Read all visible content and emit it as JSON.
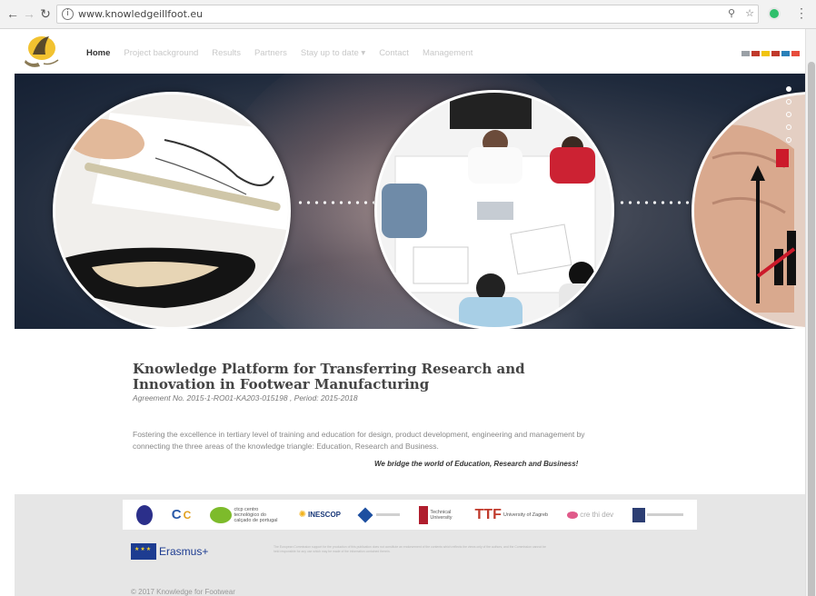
{
  "browser": {
    "url": "www.knowledgeillfoot.eu",
    "icons": [
      "back-arrow-icon",
      "forward-arrow-icon",
      "reload-icon",
      "info-icon",
      "zoom-icon",
      "star-icon",
      "extension-icon",
      "menu-icon"
    ]
  },
  "header": {
    "logo_icon": "shoe-logo-icon",
    "nav": [
      {
        "label": "Home",
        "active": true
      },
      {
        "label": "Project background"
      },
      {
        "label": "Results"
      },
      {
        "label": "Partners"
      },
      {
        "label": "Stay up to date ▾"
      },
      {
        "label": "Contact"
      },
      {
        "label": "Management"
      }
    ],
    "flags": [
      "#9aa0a6",
      "#c0392b",
      "#f1c40f",
      "#c0392b",
      "#2980b9",
      "#e74c3c"
    ]
  },
  "hero": {
    "slide_count": 5,
    "active_slide": 1,
    "images": [
      "shoe-design-sketch",
      "business-meeting-table",
      "growth-chart-hand"
    ]
  },
  "main": {
    "title": "Knowledge Platform for Transferring Research and Innovation in Footwear Manufacturing",
    "agreement": "Agreement No. 2015-1-RO01-KA203-015198 , Period: 2015-2018",
    "description": "Fostering the excellence in tertiary level of training and education for design, product development, engineering and management by connecting the three areas of the knowledge triangle: Education, Research and Business.",
    "motto": "We bridge the world of Education, Research and Business!"
  },
  "footer": {
    "partners": [
      {
        "name": "",
        "icon": "university-seal-icon",
        "color": "#2b2f8a"
      },
      {
        "name": "",
        "icon": "cec-logo-icon",
        "color": "#2a5aa8"
      },
      {
        "name": "ctcp centro tecnológico do calçado de portugal",
        "icon": "ctcp-logo-icon",
        "color": "#7dbb2b"
      },
      {
        "name": "INESCOP",
        "icon": "inescop-logo-icon",
        "color": "#1b3a7a"
      },
      {
        "name": "",
        "icon": "diamond-logo-icon",
        "color": "#1d4fa0"
      },
      {
        "name": "Technical University",
        "icon": "tu-logo-icon",
        "color": "#b01e2e"
      },
      {
        "name": "University of Zagreb",
        "icon": "zagreb-logo-icon",
        "color": "#c0392b"
      },
      {
        "name": "cre thi dev",
        "icon": "crethidev-logo-icon",
        "color": "#e05a8a"
      },
      {
        "name": "",
        "icon": "institute-logo-icon",
        "color": "#2c3e73"
      }
    ],
    "erasmus_label": "Erasmus+",
    "disclaimer": "The European Commission support for the production of this publication does not constitute an endorsement of the contents which reflects the views only of the authors, and the Commission cannot be held responsible for any use which may be made of the information contained therein.",
    "copyright": "© 2017 Knowledge for Footwear"
  }
}
